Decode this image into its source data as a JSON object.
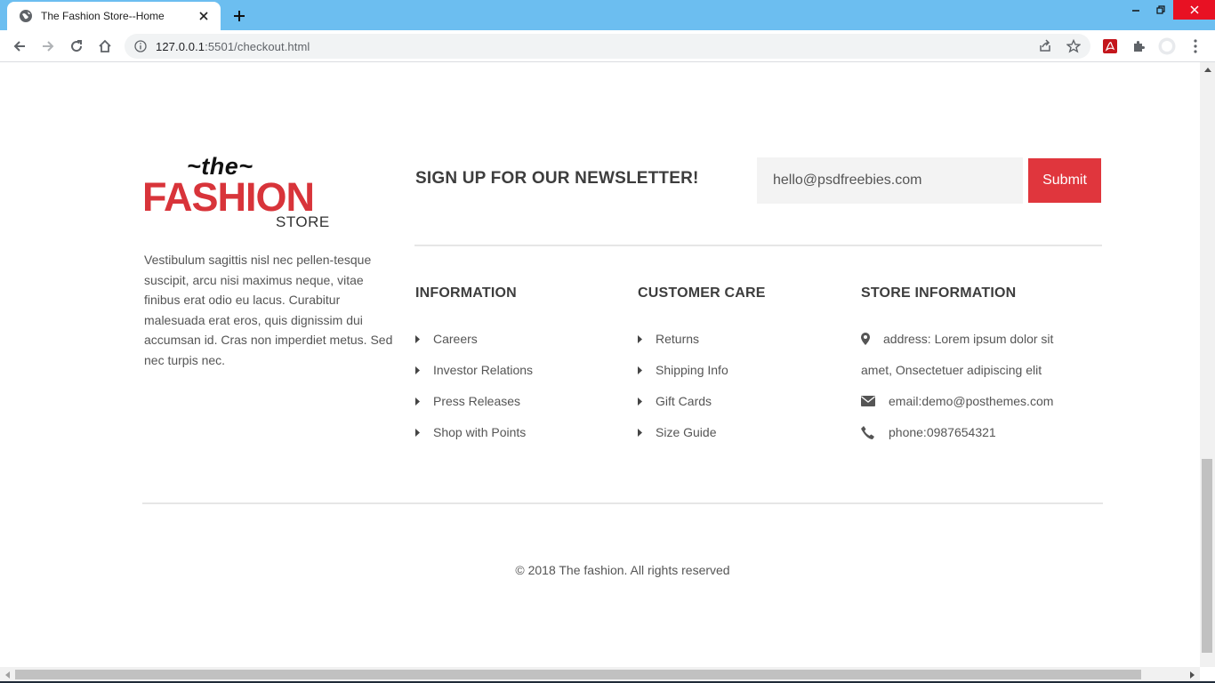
{
  "browser": {
    "tab_title": "The Fashion Store--Home",
    "url_host": "127.0.0.1",
    "url_rest": ":5501/checkout.html"
  },
  "logo": {
    "the": "~the~",
    "fashion": "FASHION",
    "store": "STORE"
  },
  "about_text": "Vestibulum sagittis nisl nec pellen-tesque suscipit, arcu nisi maximus neque, vitae finibus erat odio eu lacus. Curabitur malesuada erat eros, quis dignissim dui accumsan id. Cras non imperdiet metus. Sed nec turpis nec.",
  "newsletter": {
    "title": "SIGN UP FOR OUR NEWSLETTER!",
    "placeholder": "hello@psdfreebies.com",
    "submit_label": "Submit"
  },
  "information": {
    "title": "INFORMATION",
    "links": [
      "Careers",
      "Investor Relations",
      "Press Releases",
      "Shop with Points"
    ]
  },
  "customer_care": {
    "title": "CUSTOMER CARE",
    "links": [
      "Returns",
      "Shipping Info",
      "Gift Cards",
      "Size Guide"
    ]
  },
  "store_information": {
    "title": "STORE INFORMATION",
    "address_line1": "address: Lorem ipsum dolor sit",
    "address_line2": "amet, Onsectetuer adipiscing elit",
    "email": "email:demo@posthemes.com",
    "phone": "phone:0987654321"
  },
  "copyright": "© 2018 The fashion. All rights reserved",
  "colors": {
    "accent": "#e0363d",
    "logo_red": "#d8343a",
    "tabbar": "#6cbef0"
  }
}
